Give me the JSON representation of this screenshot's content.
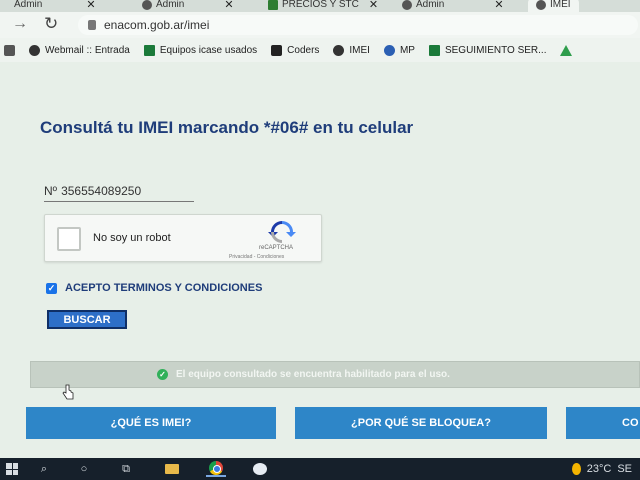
{
  "browser": {
    "tabs": [
      {
        "title": "Admin",
        "active": false
      },
      {
        "title": "Admin",
        "active": false
      },
      {
        "title": "PRECIOS Y STC",
        "active": false
      },
      {
        "title": "Admin",
        "active": false
      },
      {
        "title": "IMEI",
        "active": true
      }
    ],
    "url": "enacom.gob.ar/imei",
    "bookmarks": [
      {
        "label": "",
        "icon": "apps-icon"
      },
      {
        "label": "Webmail :: Entrada",
        "icon": "webmail-icon"
      },
      {
        "label": "Equipos icase usados",
        "icon": "sheet-icon"
      },
      {
        "label": "Coders",
        "icon": "te-icon"
      },
      {
        "label": "IMEI",
        "icon": "enacom-icon"
      },
      {
        "label": "MP",
        "icon": "mp-icon"
      },
      {
        "label": "SEGUIMIENTO SER...",
        "icon": "sheet-icon"
      },
      {
        "label": "",
        "icon": "drive-icon"
      }
    ]
  },
  "page": {
    "heading": "Consultá tu IMEI marcando *#06# en tu celular",
    "imei_label": "Nº",
    "imei_value": "356554089250",
    "captcha_label": "No soy un robot",
    "captcha_brand": "reCAPTCHA",
    "captcha_terms": "Privacidad - Condiciones",
    "terms_label": "ACEPTO TERMINOS Y CONDICIONES",
    "terms_checked": true,
    "search_button": "BUSCAR",
    "status_message": "El equipo consultado se encuentra habilitado para el uso.",
    "buttons": [
      "¿QUÉ ES IMEI?",
      "¿POR QUÉ SE BLOQUEA?",
      "CO"
    ]
  },
  "taskbar": {
    "temperature": "23°C",
    "clock": "SE"
  },
  "colors": {
    "heading": "#1f3d7a",
    "button_blue": "#2e86c8",
    "search_blue": "#2d6fc8",
    "ok_green": "#31b05a"
  }
}
